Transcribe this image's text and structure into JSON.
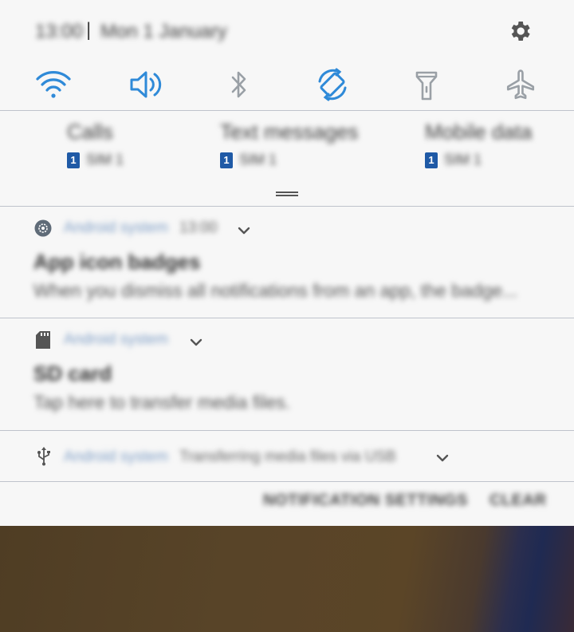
{
  "status_bar": {
    "time": "13:00",
    "date": "Mon 1 January"
  },
  "quick_toggles": [
    {
      "name": "wifi",
      "icon": "wifi-icon",
      "active": true
    },
    {
      "name": "sound",
      "icon": "speaker-icon",
      "active": true
    },
    {
      "name": "bluetooth",
      "icon": "bluetooth-icon",
      "active": false
    },
    {
      "name": "auto-rotate",
      "icon": "rotate-icon",
      "active": true
    },
    {
      "name": "flashlight",
      "icon": "flashlight-icon",
      "active": false
    },
    {
      "name": "airplane-mode",
      "icon": "airplane-icon",
      "active": false
    }
  ],
  "sim_manager": [
    {
      "label": "Calls",
      "sim_number": "1",
      "sim": "SIM 1"
    },
    {
      "label": "Text messages",
      "sim_number": "1",
      "sim": "SIM 1"
    },
    {
      "label": "Mobile data",
      "sim_number": "1",
      "sim": "SIM 1"
    }
  ],
  "notifications": [
    {
      "app": "Android system",
      "time": "13:00",
      "icon": "gear-icon",
      "title": "App icon badges",
      "text": "When you dismiss all notifications from an app, the badge..."
    },
    {
      "app": "Android system",
      "icon": "sd-card-icon",
      "title": "SD card",
      "text": "Tap here to transfer media files."
    },
    {
      "app": "Android system",
      "icon": "usb-icon",
      "summary": "Transferring media files via USB"
    }
  ],
  "actions": {
    "notification_settings": "NOTIFICATION SETTINGS",
    "clear": "CLEAR"
  },
  "colors": {
    "accent_active": "#2f8ad8",
    "icon_inactive": "#9aa0a6",
    "sim_badge": "#1f5aa6",
    "app_name": "#7e9ec6",
    "wallpaper": "#584428"
  }
}
